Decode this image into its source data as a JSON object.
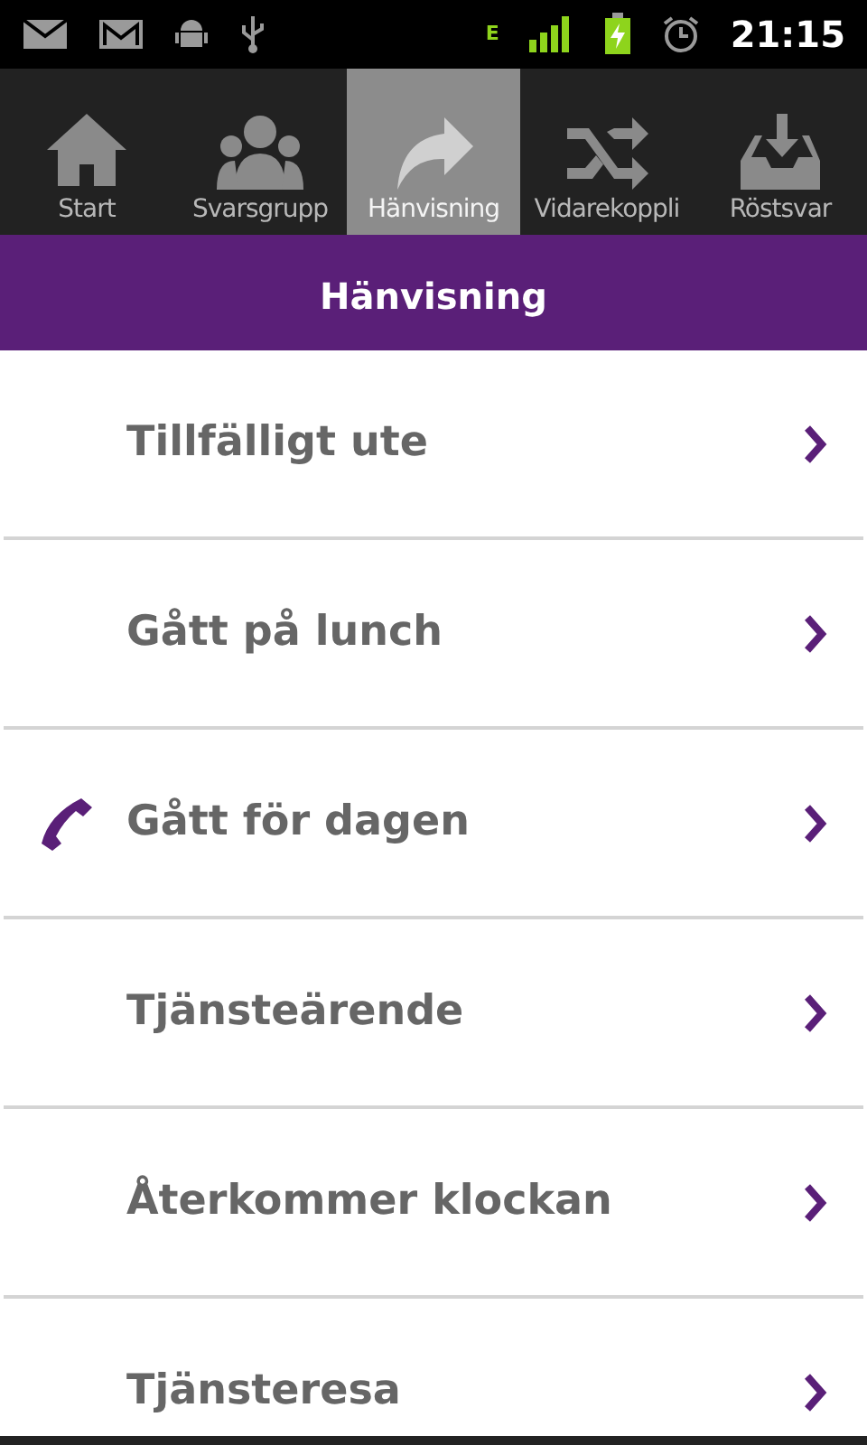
{
  "status_bar": {
    "time": "21:15",
    "network": "E"
  },
  "tabs": [
    {
      "label": "Start",
      "kind": "home",
      "selected": false
    },
    {
      "label": "Svarsgrupp",
      "kind": "group",
      "selected": false
    },
    {
      "label": "Hänvisning",
      "kind": "forward",
      "selected": true
    },
    {
      "label": "Vidarekoppli",
      "kind": "shuffle",
      "selected": false
    },
    {
      "label": "Röstsvar",
      "kind": "inbox",
      "selected": false
    }
  ],
  "header": {
    "title": "Hänvisning"
  },
  "items": [
    {
      "label": "Tillfälligt ute",
      "active": false
    },
    {
      "label": "Gått på lunch",
      "active": false
    },
    {
      "label": "Gått för dagen",
      "active": true
    },
    {
      "label": "Tjänsteärende",
      "active": false
    },
    {
      "label": "Återkommer klockan",
      "active": false
    },
    {
      "label": "Tjänsteresa",
      "active": false
    }
  ]
}
